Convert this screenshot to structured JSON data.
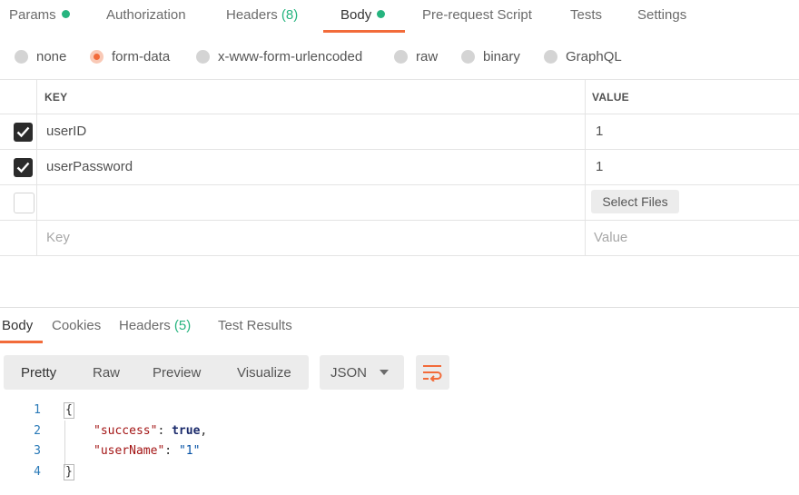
{
  "request_tabs": {
    "params": "Params",
    "authorization": "Authorization",
    "headers": "Headers",
    "headers_count": "(8)",
    "body": "Body",
    "pre_request": "Pre-request Script",
    "tests": "Tests",
    "settings": "Settings"
  },
  "body_types": {
    "none": "none",
    "form_data": "form-data",
    "urlencoded": "x-www-form-urlencoded",
    "raw": "raw",
    "binary": "binary",
    "graphql": "GraphQL",
    "selected": "form-data"
  },
  "params_table": {
    "key_header": "KEY",
    "value_header": "VALUE",
    "rows": [
      {
        "key": "userID",
        "value": "1",
        "checked": true
      },
      {
        "key": "userPassword",
        "value": "1",
        "checked": true
      }
    ],
    "select_files": "Select Files",
    "key_placeholder": "Key",
    "value_placeholder": "Value"
  },
  "response_tabs": {
    "body": "Body",
    "cookies": "Cookies",
    "headers": "Headers",
    "headers_count": "(5)",
    "test_results": "Test Results"
  },
  "response_view": {
    "pretty": "Pretty",
    "raw": "Raw",
    "preview": "Preview",
    "visualize": "Visualize",
    "format": "JSON"
  },
  "response_code": {
    "line_numbers": [
      "1",
      "2",
      "3",
      "4"
    ],
    "open_brace": "{",
    "close_brace": "}",
    "key1": "\"success\"",
    "val1": "true",
    "key2": "\"userName\"",
    "val2": "\"1\""
  },
  "colors": {
    "accent": "#f26b3a",
    "status_green": "#26b47f"
  }
}
